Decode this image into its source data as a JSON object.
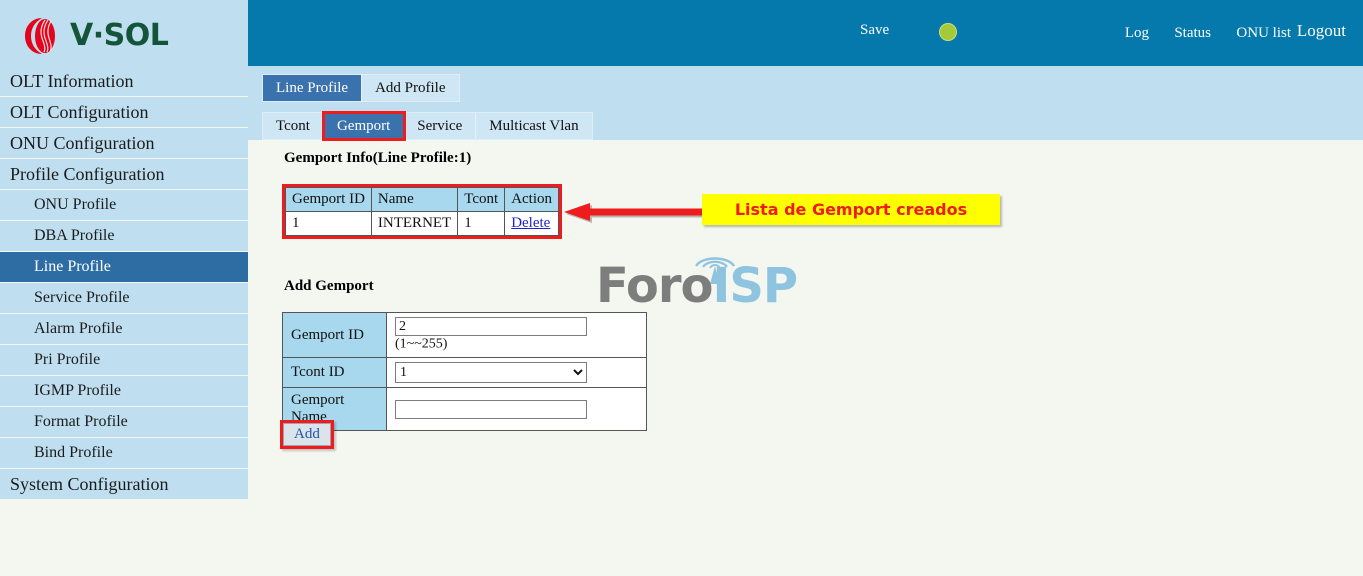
{
  "brand": {
    "logo_text": "V·SOL",
    "logo_mark": "vsol-swirl-icon",
    "logo_red": "#e2051b",
    "logo_green": "#13543a"
  },
  "header": {
    "bg_color": "#0579ab",
    "save_label": "Save",
    "status_led": "status-led-green",
    "led_color": "#a4ca39",
    "links": {
      "log": "Log",
      "status": "Status",
      "onu_list": "ONU list",
      "logout": "Logout"
    }
  },
  "sidebar": {
    "bg_color": "#bfdff0",
    "active_color": "#2e6da4",
    "items": [
      {
        "label": "OLT Information",
        "level": 0,
        "active": false
      },
      {
        "label": "OLT Configuration",
        "level": 0,
        "active": false
      },
      {
        "label": "ONU Configuration",
        "level": 0,
        "active": false
      },
      {
        "label": "Profile Configuration",
        "level": 0,
        "active": false
      },
      {
        "label": "ONU Profile",
        "level": 1,
        "active": false
      },
      {
        "label": "DBA Profile",
        "level": 1,
        "active": false
      },
      {
        "label": "Line Profile",
        "level": 1,
        "active": true
      },
      {
        "label": "Service Profile",
        "level": 1,
        "active": false
      },
      {
        "label": "Alarm Profile",
        "level": 1,
        "active": false
      },
      {
        "label": "Pri Profile",
        "level": 1,
        "active": false
      },
      {
        "label": "IGMP Profile",
        "level": 1,
        "active": false
      },
      {
        "label": "Format Profile",
        "level": 1,
        "active": false
      },
      {
        "label": "Bind Profile",
        "level": 1,
        "active": false
      },
      {
        "label": "System Configuration",
        "level": 0,
        "active": false
      }
    ]
  },
  "tabs_primary": [
    {
      "label": "Line Profile",
      "active": true,
      "highlight": false
    },
    {
      "label": "Add Profile",
      "active": false,
      "highlight": false
    }
  ],
  "tabs_secondary": [
    {
      "label": "Tcont",
      "active": false,
      "highlight": false
    },
    {
      "label": "Gemport",
      "active": true,
      "highlight": true
    },
    {
      "label": "Service",
      "active": false,
      "highlight": false
    },
    {
      "label": "Multicast Vlan",
      "active": false,
      "highlight": false
    }
  ],
  "main": {
    "gemport_info_title": "Gemport Info(Line Profile:1)",
    "info_table": {
      "headers": [
        "Gemport ID",
        "Name",
        "Tcont",
        "Action"
      ],
      "rows": [
        {
          "gemport_id": "1",
          "name": "INTERNET",
          "tcont": "1",
          "action": "Delete"
        }
      ]
    },
    "annotation": {
      "text": "Lista de Gemport creados",
      "box_color": "#ffff00",
      "text_color": "#ee1c1c",
      "arrow_color": "#ee1c1c",
      "highlight_color": "#ee1c1c"
    },
    "add_gemport": {
      "title": "Add Gemport",
      "fields": {
        "gemport_id_label": "Gemport ID",
        "gemport_id_value": "2",
        "gemport_id_placeholder": "",
        "gemport_id_hint": "(1~~255)",
        "tcont_id_label": "Tcont ID",
        "tcont_id_value": "1",
        "tcont_id_options": [
          "1"
        ],
        "gemport_name_label": "Gemport Name",
        "gemport_name_value": "",
        "gemport_name_placeholder": ""
      },
      "add_button_label": "Add"
    },
    "watermark": {
      "part1": "Foro",
      "part2": "ISP",
      "mark": "antenna-tower-icon"
    }
  }
}
